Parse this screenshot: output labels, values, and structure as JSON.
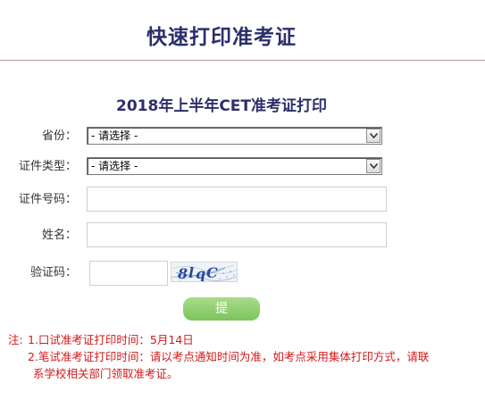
{
  "header": {
    "title": "快速打印准考证"
  },
  "form": {
    "title": "2018年上半年CET准考证打印",
    "fields": [
      {
        "label": "省份：",
        "value": "- 请选择 -"
      },
      {
        "label": "证件类型：",
        "value": "- 请选择 -"
      },
      {
        "label": "证件号码：",
        "value": ""
      },
      {
        "label": "姓名：",
        "value": ""
      }
    ],
    "captcha": {
      "label": "验证码：",
      "value": "",
      "image_text": "8lqC"
    },
    "submit_label": "提 交"
  },
  "notes": {
    "prefix": "注:",
    "line1": "1.口试准考证打印时间：5月14日",
    "line2": "2.笔试准考证打印时间：请以考点通知时间为准，如考点采用集体打印方式，请联",
    "line3": "系学校相关部门领取准考证。"
  },
  "colors": {
    "title": "#2b2f6b",
    "button": "#8fd06e",
    "note": "#d21a1a",
    "divider": "#b896a8"
  }
}
